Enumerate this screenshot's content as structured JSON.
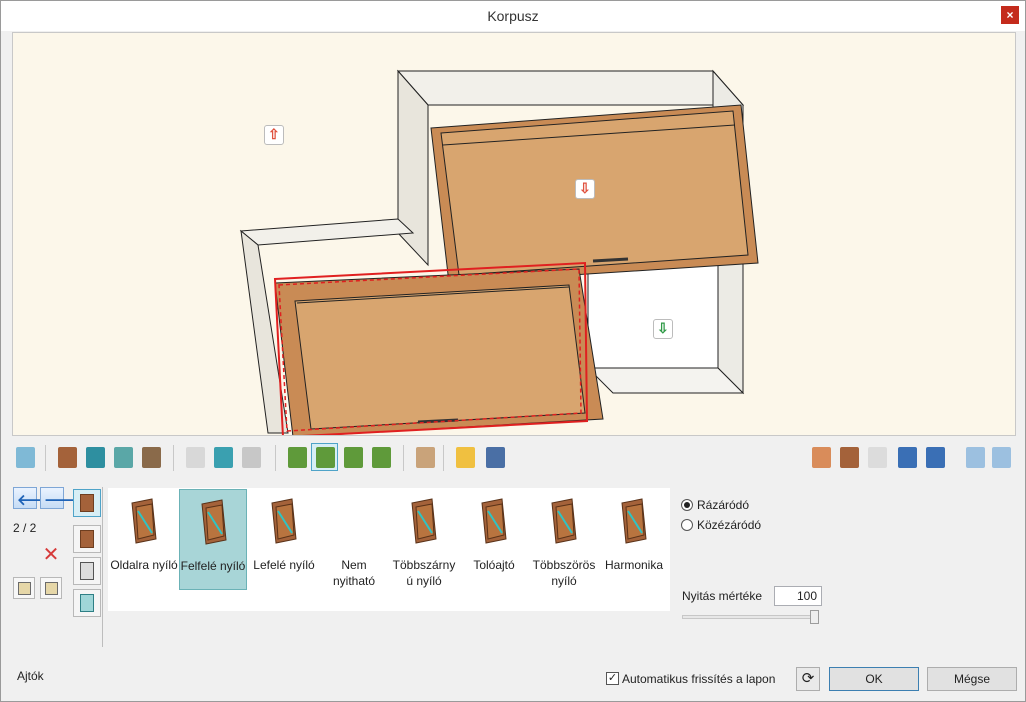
{
  "window": {
    "title": "Korpusz",
    "close_glyph": "×"
  },
  "viewport": {
    "markers": [
      {
        "name": "open-up-marker",
        "icon": "arrow-up-out-icon",
        "color": "#e0523f"
      },
      {
        "name": "open-down-marker",
        "icon": "arrow-down-in-icon",
        "color": "#e0523f"
      },
      {
        "name": "shelf-marker",
        "icon": "arrow-down-in-icon",
        "color": "#2f9a47"
      }
    ]
  },
  "toolbar_left": [
    {
      "name": "dimensions-tool",
      "icon": "dimensions-icon"
    },
    {
      "name": "panel-tool-1",
      "icon": "panel-brown-icon"
    },
    {
      "name": "panel-tool-2",
      "icon": "panel-teal-icon"
    },
    {
      "name": "panel-tool-3",
      "icon": "panel-frame-icon"
    },
    {
      "name": "panel-tool-4",
      "icon": "handle-icon"
    },
    {
      "name": "cabinet-tool-1",
      "icon": "cabinet-outline-icon"
    },
    {
      "name": "cabinet-tool-2",
      "icon": "cabinet-teal-icon"
    },
    {
      "name": "cabinet-tool-3",
      "icon": "cabinet-split-icon"
    },
    {
      "name": "add-tool-1",
      "icon": "add-door-icon"
    },
    {
      "name": "add-tool-2",
      "icon": "add-flap-icon",
      "active": true
    },
    {
      "name": "add-tool-3",
      "icon": "add-drawer-icon"
    },
    {
      "name": "add-tool-4",
      "icon": "add-shelf-icon"
    },
    {
      "name": "legs-tool",
      "icon": "legs-icon"
    },
    {
      "name": "edit-tool",
      "icon": "pencil-icon"
    },
    {
      "name": "save-tool",
      "icon": "save-icon"
    }
  ],
  "toolbar_right": [
    {
      "name": "fit-view-tool",
      "icon": "fit-view-icon"
    },
    {
      "name": "rotate-view-tool",
      "icon": "rotate-view-icon"
    },
    {
      "name": "box-view-tool",
      "icon": "box-view-icon"
    },
    {
      "name": "undo-tool",
      "icon": "undo-icon"
    },
    {
      "name": "redo-tool",
      "icon": "redo-icon"
    },
    {
      "name": "zoom-in-tool",
      "icon": "zoom-in-icon"
    },
    {
      "name": "zoom-out-tool",
      "icon": "zoom-out-icon"
    }
  ],
  "left_panel": {
    "prev_glyph": "🡐",
    "next_glyph": "🡒",
    "page_counter": "2 / 2",
    "delete_glyph": "✕"
  },
  "door_types": [
    {
      "label": "Oldalra nyíló",
      "icon": "side-opening-door-icon"
    },
    {
      "label": "Felfelé nyíló",
      "icon": "upward-opening-door-icon",
      "selected": true
    },
    {
      "label": "Lefelé nyíló",
      "icon": "downward-opening-door-icon"
    },
    {
      "label": "Nem nyitható",
      "icon": ""
    },
    {
      "label": "Többszárny ú nyíló",
      "icon": "multi-leaf-door-icon"
    },
    {
      "label": "Tolóajtó",
      "icon": "sliding-door-icon"
    },
    {
      "label": "Többszörös nyíló",
      "icon": "multiple-opening-door-icon"
    },
    {
      "label": "Harmonika",
      "icon": "folding-door-icon"
    }
  ],
  "options": {
    "radio_1": "Rázáródó",
    "radio_2": "Közézáródó",
    "radio_selected": "Rázáródó",
    "opening_label": "Nyitás mértéke",
    "opening_value": "100",
    "opening_fraction": 1.0
  },
  "footer": {
    "status": "Ajtók",
    "auto_refresh_label": "Automatikus frissítés a lapon",
    "auto_refresh_checked": true,
    "check_glyph": "✓",
    "refresh_glyph": "⟳",
    "ok_label": "OK",
    "cancel_label": "Mégse"
  },
  "colors": {
    "wood": "#d8a56f",
    "wood_edge": "#b9784a",
    "selection": "#e02020",
    "viewport_bg": "#fcf7ea"
  }
}
